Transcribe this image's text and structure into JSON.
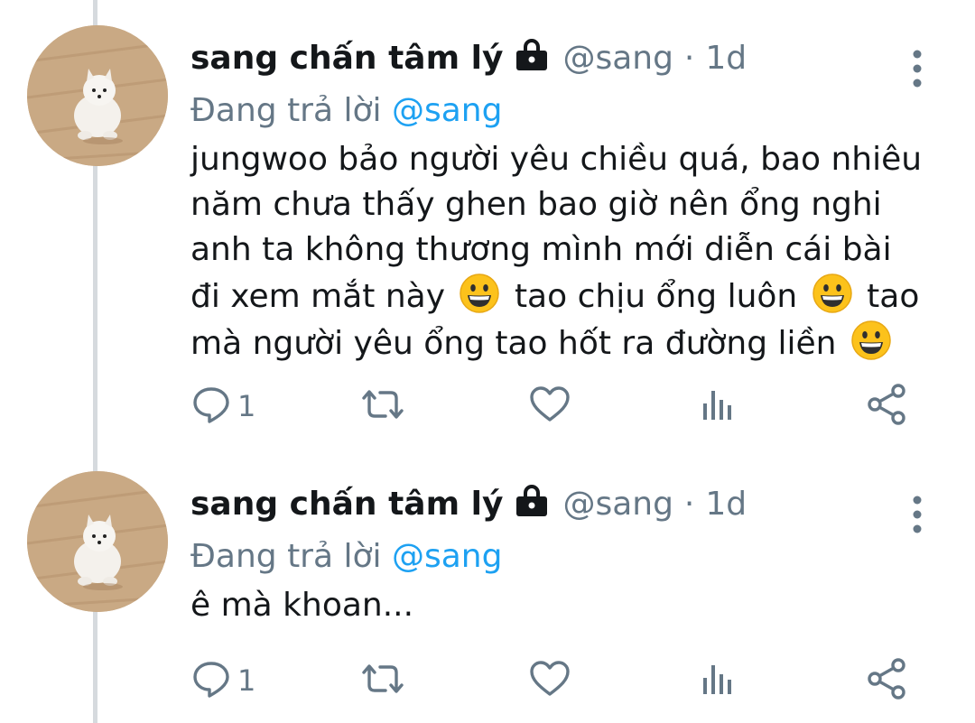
{
  "tweets": [
    {
      "author_name": "sang chấn tâm lý",
      "handle": "@sang",
      "separator": "·",
      "time": "1d",
      "reply_prefix": "Đang trả lời",
      "reply_handle": "@sang",
      "lines": [
        [
          "jungwoo bảo người yêu chiều quá, bao nhiêu"
        ],
        [
          "năm chưa thấy ghen bao giờ nên ổng nghi"
        ],
        [
          "anh ta không thương mình mới diễn cái bài"
        ],
        [
          "đi xem mắt này",
          "tao chịu ổng luôn",
          "tao"
        ],
        [
          "mà người yêu ổng tao hốt ra đường liền"
        ]
      ],
      "reply_count": "1"
    },
    {
      "author_name": "sang chấn tâm lý",
      "handle": "@sang",
      "separator": "·",
      "time": "1d",
      "reply_prefix": "Đang trả lời",
      "reply_handle": "@sang",
      "lines": [
        [
          "ê mà khoan..."
        ]
      ],
      "reply_count": "1"
    }
  ],
  "icons": {
    "lock": "lock-icon",
    "more": "more-vertical-icon",
    "reply": "reply-icon",
    "retweet": "retweet-icon",
    "like": "heart-icon",
    "analytics": "analytics-icon",
    "share": "share-icon",
    "emoji": "grinning-face-emoji"
  },
  "colors": {
    "text": "#14171a",
    "muted": "#657786",
    "accent": "#1da1f2",
    "thread_line": "#d6dade"
  }
}
